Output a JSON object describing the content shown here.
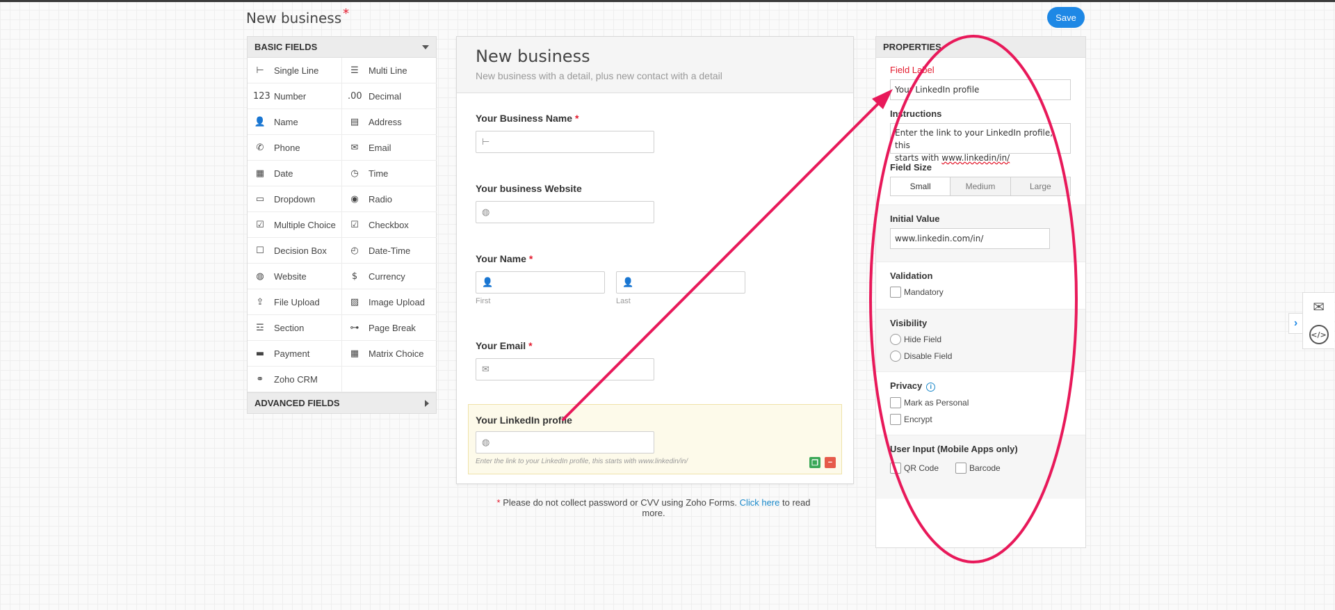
{
  "header": {
    "title": "New business",
    "required_mark": "*",
    "save_label": "Save"
  },
  "palette": {
    "basic_title": "BASIC FIELDS",
    "advanced_title": "ADVANCED FIELDS",
    "items": [
      {
        "label": "Single Line",
        "icon": "single-line-icon",
        "glyph": "⊢"
      },
      {
        "label": "Multi Line",
        "icon": "multi-line-icon",
        "glyph": "☰"
      },
      {
        "label": "Number",
        "icon": "number-icon",
        "glyph": "123"
      },
      {
        "label": "Decimal",
        "icon": "decimal-icon",
        "glyph": ".00"
      },
      {
        "label": "Name",
        "icon": "person-icon",
        "glyph": "👤"
      },
      {
        "label": "Address",
        "icon": "address-icon",
        "glyph": "▤"
      },
      {
        "label": "Phone",
        "icon": "phone-icon",
        "glyph": "✆"
      },
      {
        "label": "Email",
        "icon": "envelope-icon",
        "glyph": "✉"
      },
      {
        "label": "Date",
        "icon": "calendar-icon",
        "glyph": "▦"
      },
      {
        "label": "Time",
        "icon": "clock-icon",
        "glyph": "◷"
      },
      {
        "label": "Dropdown",
        "icon": "dropdown-icon",
        "glyph": "▭"
      },
      {
        "label": "Radio",
        "icon": "radio-icon",
        "glyph": "◉"
      },
      {
        "label": "Multiple Choice",
        "icon": "multiple-choice-icon",
        "glyph": "☑"
      },
      {
        "label": "Checkbox",
        "icon": "checkbox-icon",
        "glyph": "☑"
      },
      {
        "label": "Decision Box",
        "icon": "decision-box-icon",
        "glyph": "☐"
      },
      {
        "label": "Date-Time",
        "icon": "date-time-icon",
        "glyph": "◴"
      },
      {
        "label": "Website",
        "icon": "globe-icon",
        "glyph": "◍"
      },
      {
        "label": "Currency",
        "icon": "currency-icon",
        "glyph": "$"
      },
      {
        "label": "File Upload",
        "icon": "upload-icon",
        "glyph": "⇪"
      },
      {
        "label": "Image Upload",
        "icon": "image-upload-icon",
        "glyph": "▨"
      },
      {
        "label": "Section",
        "icon": "section-icon",
        "glyph": "☲"
      },
      {
        "label": "Page Break",
        "icon": "page-break-icon",
        "glyph": "⊶"
      },
      {
        "label": "Payment",
        "icon": "payment-icon",
        "glyph": "▬"
      },
      {
        "label": "Matrix Choice",
        "icon": "matrix-icon",
        "glyph": "▦"
      },
      {
        "label": "Zoho CRM",
        "icon": "handshake-icon",
        "glyph": "⚭"
      },
      {
        "label": "",
        "icon": "",
        "glyph": ""
      }
    ]
  },
  "form": {
    "title": "New business",
    "description": "New business with a detail, plus new contact with a detail",
    "required_mark": "*",
    "fields": {
      "business_name": "Your Business Name",
      "business_website": "Your business Website",
      "name": "Your Name",
      "name_first": "First",
      "name_last": "Last",
      "email": "Your Email",
      "linkedin": "Your LinkedIn profile",
      "linkedin_help": "Enter the link to your LinkedIn profile, this starts with www.linkedin/in/"
    },
    "icons": {
      "single_line": "⊢",
      "globe": "◍",
      "person": "👤",
      "envelope": "✉"
    }
  },
  "note": {
    "mark": "*",
    "text_before": "Please do not collect password or CVV using Zoho Forms.",
    "link": "Click here",
    "text_after": "to read more."
  },
  "properties": {
    "title": "PROPERTIES",
    "field_label_title": "Field Label",
    "field_label_value": "Your LinkedIn profile",
    "instructions_title": "Instructions",
    "instructions_line1": "Enter the link to your LinkedIn profile, this",
    "instructions_line2_pre": "starts with ",
    "instructions_line2_link": "www.linkedin/in/",
    "field_size_title": "Field Size",
    "sizes": [
      "Small",
      "Medium",
      "Large"
    ],
    "size_selected": "Small",
    "initial_value_title": "Initial Value",
    "initial_value": "www.linkedin.com/in/",
    "validation_title": "Validation",
    "mandatory": "Mandatory",
    "visibility_title": "Visibility",
    "hide_field": "Hide Field",
    "disable_field": "Disable Field",
    "privacy_title": "Privacy",
    "mark_personal": "Mark as Personal",
    "encrypt": "Encrypt",
    "user_input_title": "User Input (Mobile Apps only)",
    "qr_code": "QR Code",
    "barcode": "Barcode"
  },
  "side_tools": {
    "toggle": "›",
    "mail": "✉",
    "embed": "</>"
  },
  "annotation": {
    "color": "#e8195a"
  },
  "colors": {
    "accent": "#1e88e5",
    "required": "#e3192c",
    "link": "#1a88c9"
  }
}
